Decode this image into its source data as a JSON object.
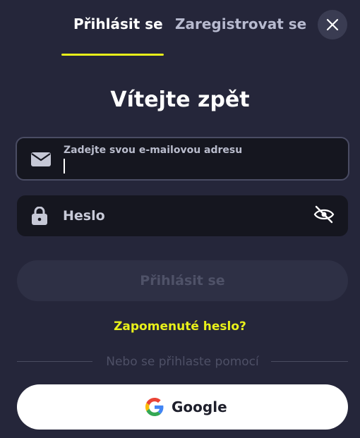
{
  "tabs": {
    "login": "Přihlásit se",
    "register": "Zaregistrovat se"
  },
  "heading": "Vítejte zpět",
  "email": {
    "label": "Zadejte svou e-mailovou adresu",
    "value": ""
  },
  "password": {
    "placeholder": "Heslo"
  },
  "submit_label": "Přihlásit se",
  "forgot_label": "Zapomenuté heslo?",
  "divider_text": "Nebo se přihlaste pomocí",
  "google_label": "Google",
  "colors": {
    "background": "#25263a",
    "accent": "#e8f01a",
    "field": "#15161f",
    "button_disabled": "#2e3045"
  },
  "icons": [
    "close-icon",
    "mail-icon",
    "lock-icon",
    "eye-off-icon",
    "google-icon"
  ]
}
